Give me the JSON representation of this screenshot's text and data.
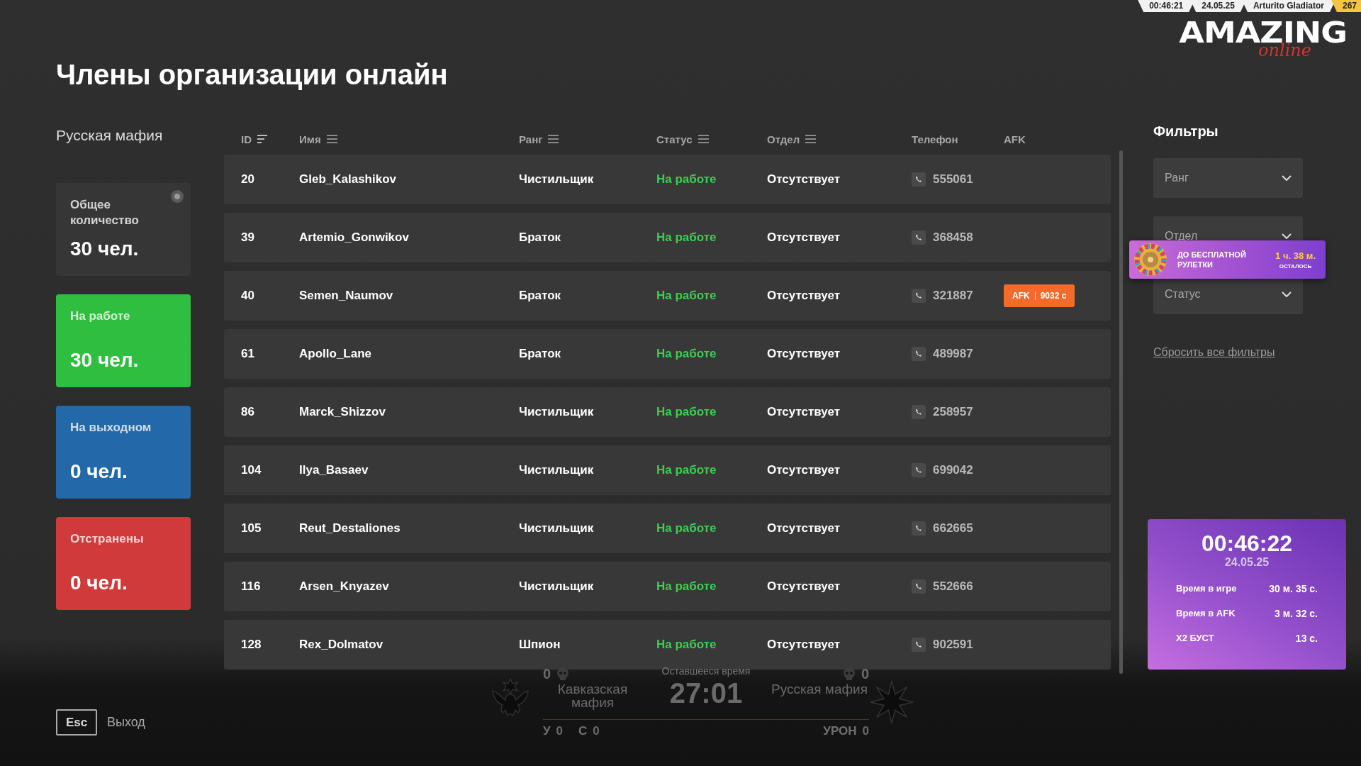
{
  "top_bar": {
    "time": "00:46:21",
    "date": "24.05.25",
    "player": "Arturito Gladiator",
    "player_id": "267"
  },
  "logo": {
    "word": "AMAZING",
    "sub": "online"
  },
  "title": "Члены организации онлайн",
  "organization": "Русская мафия",
  "summary_cards": [
    {
      "kind": "total",
      "label": "Общее количество",
      "count": "30 чел."
    },
    {
      "kind": "working",
      "label": "На работе",
      "count": "30 чел."
    },
    {
      "kind": "off",
      "label": "На выходном",
      "count": "0 чел."
    },
    {
      "kind": "suspended",
      "label": "Отстранены",
      "count": "0 чел."
    }
  ],
  "table": {
    "columns": [
      {
        "label": "ID",
        "kind": "sort"
      },
      {
        "label": "Имя",
        "kind": "filter"
      },
      {
        "label": "Ранг",
        "kind": "filter"
      },
      {
        "label": "Статус",
        "kind": "filter"
      },
      {
        "label": "Отдел",
        "kind": "filter"
      },
      {
        "label": "Телефон",
        "kind": "plain"
      },
      {
        "label": "AFK",
        "kind": "plain"
      }
    ],
    "rows": [
      {
        "id": "20",
        "name": "Gleb_Kalashikov",
        "rank": "Чистильщик",
        "status": "На работе",
        "department": "Отсутствует",
        "phone": "555061"
      },
      {
        "id": "39",
        "name": "Artemio_Gonwikov",
        "rank": "Браток",
        "status": "На работе",
        "department": "Отсутствует",
        "phone": "368458"
      },
      {
        "id": "40",
        "name": "Semen_Naumov",
        "rank": "Браток",
        "status": "На работе",
        "department": "Отсутствует",
        "phone": "321887",
        "afk": {
          "label": "AFK",
          "time": "9032 с"
        }
      },
      {
        "id": "61",
        "name": "Apollo_Lane",
        "rank": "Браток",
        "status": "На работе",
        "department": "Отсутствует",
        "phone": "489987"
      },
      {
        "id": "86",
        "name": "Marck_Shizzov",
        "rank": "Чистильщик",
        "status": "На работе",
        "department": "Отсутствует",
        "phone": "258957"
      },
      {
        "id": "104",
        "name": "Ilya_Basaev",
        "rank": "Чистильщик",
        "status": "На работе",
        "department": "Отсутствует",
        "phone": "699042"
      },
      {
        "id": "105",
        "name": "Reut_Destaliones",
        "rank": "Чистильщик",
        "status": "На работе",
        "department": "Отсутствует",
        "phone": "662665"
      },
      {
        "id": "116",
        "name": "Arsen_Knyazev",
        "rank": "Чистильщик",
        "status": "На работе",
        "department": "Отсутствует",
        "phone": "552666"
      },
      {
        "id": "128",
        "name": "Rex_Dolmatov",
        "rank": "Шпион",
        "status": "На работе",
        "department": "Отсутствует",
        "phone": "902591"
      }
    ]
  },
  "filters": {
    "title": "Фильтры",
    "dropdowns": [
      {
        "placeholder": "Ранг"
      },
      {
        "placeholder": "Отдел"
      },
      {
        "placeholder": "Статус"
      }
    ],
    "reset": "Сбросить все фильтры"
  },
  "roulette_banner": {
    "text": "ДО БЕСПЛАТНОЙ РУЛЕТКИ",
    "time": "1 ч. 38 м.",
    "note": "ОСТАЛОСЬ"
  },
  "session": {
    "time": "00:46:22",
    "date": "24.05.25",
    "stats": [
      {
        "label": "Время в игре",
        "value": "30 м. 35 с."
      },
      {
        "label": "Время в AFK",
        "value": "3 м. 32 с."
      },
      {
        "label": "X2 БУСТ",
        "value": "13 с."
      }
    ]
  },
  "exit": {
    "key": "Esc",
    "label": "Выход"
  },
  "scoreboard": {
    "left_kills": "0",
    "left_team": "Кавказская мафия",
    "caption": "Оставшееся время",
    "timer": "27:01",
    "right_team": "Русская мафия",
    "right_kills": "0",
    "left_stats": [
      {
        "label": "У",
        "value": "0"
      },
      {
        "label": "С",
        "value": "0"
      }
    ],
    "right_stats": [
      {
        "label": "УРОН",
        "value": "0"
      }
    ]
  }
}
